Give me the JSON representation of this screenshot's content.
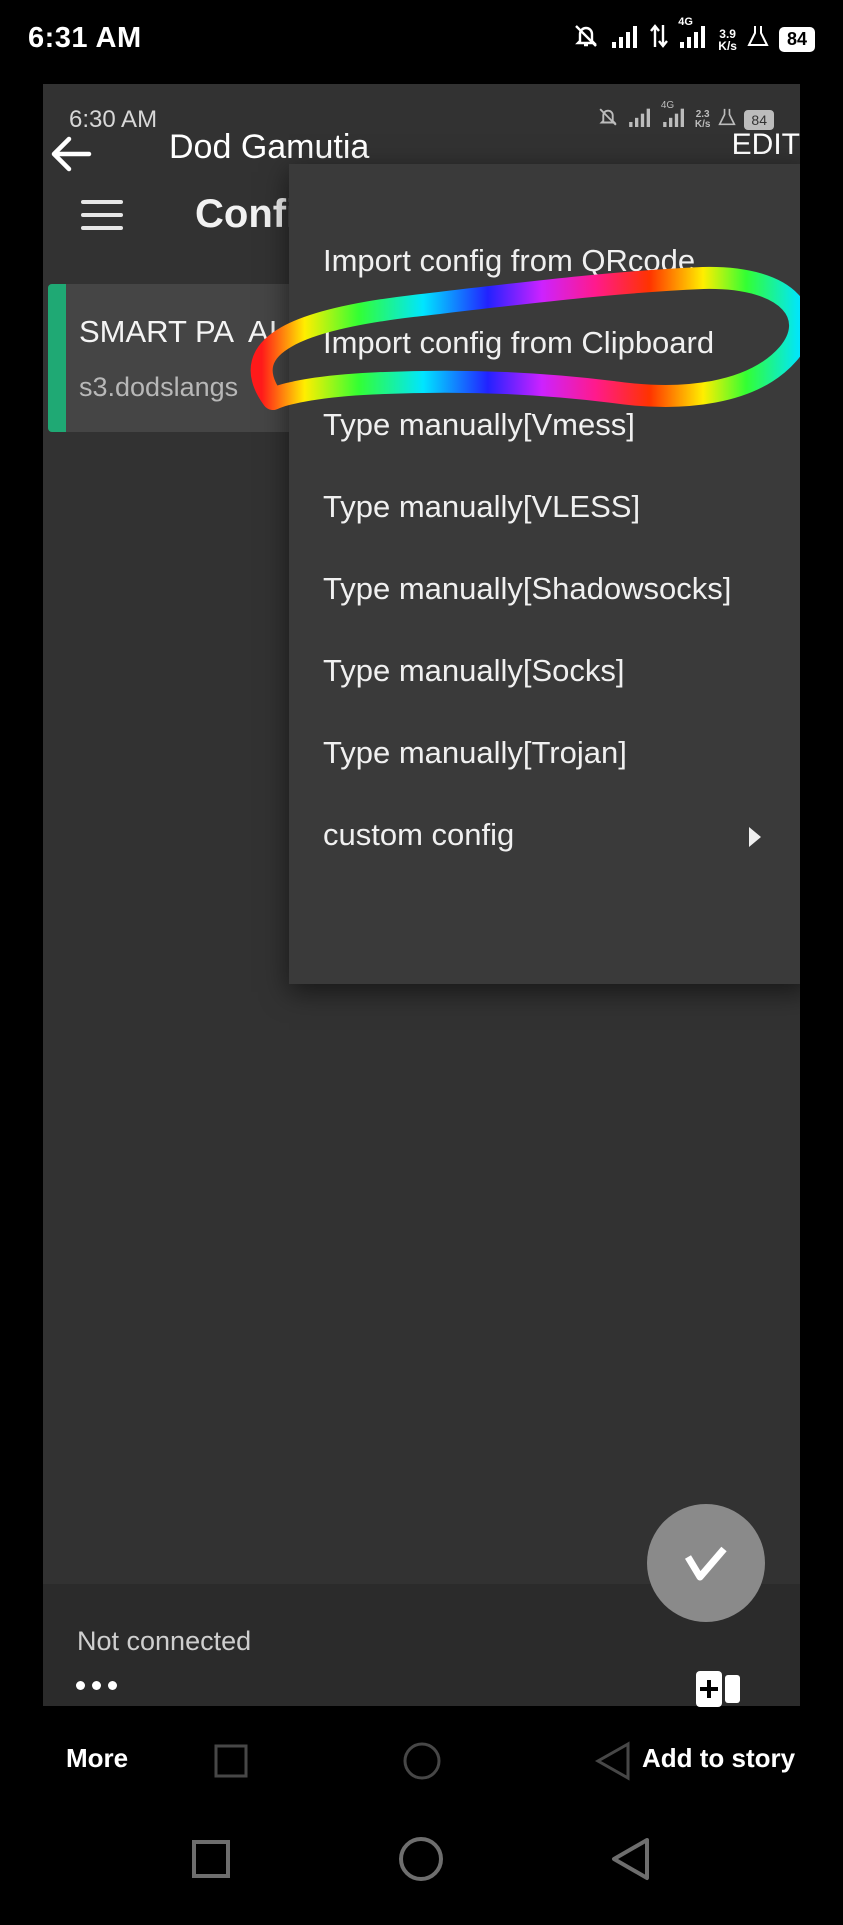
{
  "status_bar": {
    "time": "6:31 AM",
    "net_speed_value": "3.9",
    "net_speed_unit": "K/s",
    "network_type": "4G",
    "battery": "84"
  },
  "inner_status_bar": {
    "time": "6:30 AM",
    "net_speed_value": "2.3",
    "net_speed_unit": "K/s",
    "network_type": "4G",
    "battery": "84"
  },
  "story_header": {
    "title": "Dod Gamutia",
    "edit_label": "EDIT"
  },
  "app": {
    "title": "Confi",
    "config_card": {
      "name": "SMART PA",
      "name_tail": "AI",
      "host": "s3.dodslangs",
      "accent_color": "#1fa974"
    },
    "status_text": "Not connected"
  },
  "menu": {
    "items": [
      "Import config from QRcode",
      "Import config from Clipboard",
      "Type manually[Vmess]",
      "Type manually[VLESS]",
      "Type manually[Shadowsocks]",
      "Type manually[Socks]",
      "Type manually[Trojan]",
      "custom config"
    ]
  },
  "story_footer": {
    "more_label": "More",
    "add_to_story_label": "Add to story"
  },
  "icons": {
    "back": "arrow-left-icon",
    "menu": "hamburger-icon",
    "fab": "v-connect-icon",
    "submenu": "caret-right-icon",
    "add_story": "add-story-icon"
  }
}
